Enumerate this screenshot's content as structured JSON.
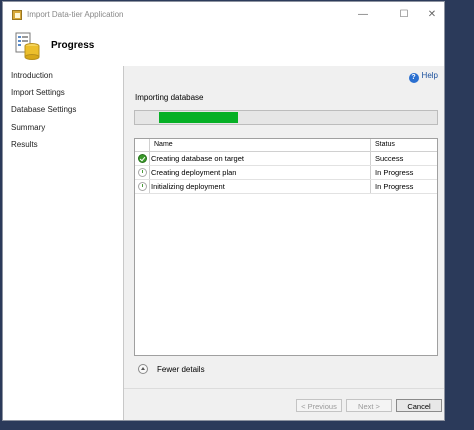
{
  "window": {
    "title": "Import Data-tier Application",
    "minimize_glyph": "—",
    "maximize_glyph": "☐",
    "close_glyph": "✕"
  },
  "header": {
    "title": "Progress",
    "icon": "wizard-database-icon"
  },
  "sidebar": {
    "items": [
      {
        "label": "Introduction"
      },
      {
        "label": "Import Settings"
      },
      {
        "label": "Database Settings"
      },
      {
        "label": "Summary"
      },
      {
        "label": "Results"
      }
    ]
  },
  "main": {
    "help_label": "Help",
    "status_text": "Importing database",
    "progress_fraction": 0.26,
    "grid": {
      "columns": [
        "Name",
        "Status"
      ],
      "rows": [
        {
          "name": "Creating database on target",
          "status": "Success",
          "icon": "success-check-icon"
        },
        {
          "name": "Creating deployment plan",
          "status": "In Progress",
          "icon": "in-progress-icon"
        },
        {
          "name": "Initializing deployment",
          "status": "In Progress",
          "icon": "in-progress-icon"
        }
      ]
    },
    "fewer_details_label": "Fewer details"
  },
  "buttons": {
    "previous": "< Previous",
    "next": "Next >",
    "cancel": "Cancel"
  },
  "colors": {
    "progress_fill": "#06b025",
    "desktop": "#2b3a5a",
    "help_link": "#1a4f9c"
  }
}
